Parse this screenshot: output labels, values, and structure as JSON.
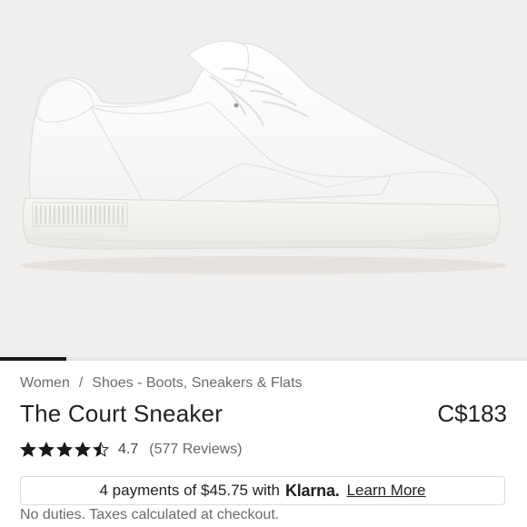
{
  "product": {
    "image_alt": "white leather court sneaker, side view",
    "carousel_progress": 0.125,
    "breadcrumb": [
      "Women",
      "Shoes - Boots, Sneakers & Flats"
    ],
    "breadcrumb_separator": "/",
    "title": "The Court Sneaker",
    "price": "C$183",
    "rating": {
      "value": "4.7",
      "stars": 4.5,
      "reviews_label": "(577 Reviews)"
    },
    "klarna": {
      "prefix": "4 payments of $45.75 with",
      "brand": "Klarna.",
      "link_label": "Learn More"
    },
    "duties_note": "No duties. Taxes calculated at checkout."
  },
  "colors": {
    "hero_bg": "#f0efed",
    "text": "#222222",
    "muted": "#6b6b6b",
    "progress": "#1a1a1a"
  }
}
